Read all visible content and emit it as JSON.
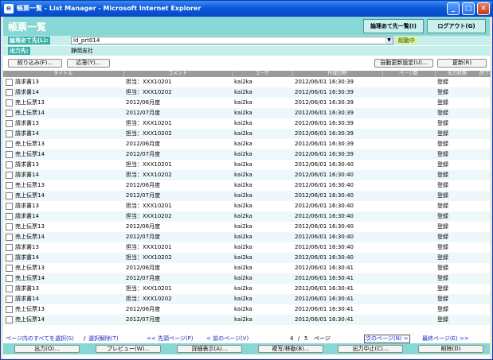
{
  "window": {
    "title": "帳票一覧 - List Manager - Microsoft Internet Explorer",
    "minimize": "_",
    "maximize": "□",
    "close": "✕"
  },
  "header": {
    "title": "帳票一覧",
    "logical_dest_button": "論理あて先一覧(I)",
    "logout_button": "ログアウト(G)"
  },
  "filter": {
    "dest_label": "論理あて先(L):",
    "dest_value": "ld_prt014",
    "dest_dropdown": "▼",
    "status": "起動中",
    "output_label": "出力先:",
    "output_value": "静岡支社"
  },
  "toolbar": {
    "narrow": "絞り込み(F)...",
    "respond": "応答(Y)...",
    "auto_refresh": "自動更新設定(U)...",
    "refresh": "更新(R)"
  },
  "table": {
    "columns": [
      "タイトル",
      "コメント",
      "ユーザ",
      "作成日時",
      "ページ数",
      "出力状態",
      "完了"
    ],
    "rows": [
      [
        "請求書13",
        "担当：XXX10201",
        "kai2ka",
        "2012/06/01 16:30:39",
        "",
        "登録",
        ""
      ],
      [
        "請求書14",
        "担当：XXX10202",
        "kai2ka",
        "2012/06/01 16:30:39",
        "",
        "登録",
        ""
      ],
      [
        "売上伝票13",
        "2012/06月度",
        "kai2ka",
        "2012/06/01 16:30:39",
        "",
        "登録",
        ""
      ],
      [
        "売上伝票14",
        "2012/07月度",
        "kai2ka",
        "2012/06/01 16:30:39",
        "",
        "登録",
        ""
      ],
      [
        "請求書13",
        "担当：XXX10201",
        "kai2ka",
        "2012/06/01 16:30:39",
        "",
        "登録",
        ""
      ],
      [
        "請求書14",
        "担当：XXX10202",
        "kai2ka",
        "2012/06/01 16:30:39",
        "",
        "登録",
        ""
      ],
      [
        "売上伝票13",
        "2012/06月度",
        "kai2ka",
        "2012/06/01 16:30:39",
        "",
        "登録",
        ""
      ],
      [
        "売上伝票14",
        "2012/07月度",
        "kai2ka",
        "2012/06/01 16:30:39",
        "",
        "登録",
        ""
      ],
      [
        "請求書13",
        "担当：XXX10201",
        "kai2ka",
        "2012/06/01 16:30:40",
        "",
        "登録",
        ""
      ],
      [
        "請求書14",
        "担当：XXX10202",
        "kai2ka",
        "2012/06/01 16:30:40",
        "",
        "登録",
        ""
      ],
      [
        "売上伝票13",
        "2012/06月度",
        "kai2ka",
        "2012/06/01 16:30:40",
        "",
        "登録",
        ""
      ],
      [
        "売上伝票14",
        "2012/07月度",
        "kai2ka",
        "2012/06/01 16:30:40",
        "",
        "登録",
        ""
      ],
      [
        "請求書13",
        "担当：XXX10201",
        "kai2ka",
        "2012/06/01 16:30:40",
        "",
        "登録",
        ""
      ],
      [
        "請求書14",
        "担当：XXX10202",
        "kai2ka",
        "2012/06/01 16:30:40",
        "",
        "登録",
        ""
      ],
      [
        "売上伝票13",
        "2012/06月度",
        "kai2ka",
        "2012/06/01 16:30:40",
        "",
        "登録",
        ""
      ],
      [
        "売上伝票14",
        "2012/07月度",
        "kai2ka",
        "2012/06/01 16:30:40",
        "",
        "登録",
        ""
      ],
      [
        "請求書13",
        "担当：XXX10201",
        "kai2ka",
        "2012/06/01 16:30:40",
        "",
        "登録",
        ""
      ],
      [
        "請求書14",
        "担当：XXX10202",
        "kai2ka",
        "2012/06/01 16:30:40",
        "",
        "登録",
        ""
      ],
      [
        "売上伝票13",
        "2012/06月度",
        "kai2ka",
        "2012/06/01 16:30:41",
        "",
        "登録",
        ""
      ],
      [
        "売上伝票14",
        "2012/07月度",
        "kai2ka",
        "2012/06/01 16:30:41",
        "",
        "登録",
        ""
      ],
      [
        "請求書13",
        "担当：XXX10201",
        "kai2ka",
        "2012/06/01 16:30:41",
        "",
        "登録",
        ""
      ],
      [
        "請求書14",
        "担当：XXX10202",
        "kai2ka",
        "2012/06/01 16:30:41",
        "",
        "登録",
        ""
      ],
      [
        "売上伝票13",
        "2012/06月度",
        "kai2ka",
        "2012/06/01 16:30:41",
        "",
        "登録",
        ""
      ],
      [
        "売上伝票14",
        "2012/07月度",
        "kai2ka",
        "2012/06/01 16:30:41",
        "",
        "登録",
        ""
      ]
    ]
  },
  "pager": {
    "select_all": "ページ内のすべてを選択(S)",
    "separator": "/",
    "deselect": "選択解除(T)",
    "first": "<< 先頭ページ(P)",
    "prev": "< 前のページ(V)",
    "current": "4",
    "slash": "/",
    "total": "5",
    "page_word": "ページ",
    "next": "次のページ(N) >",
    "last": "最終ページ(E) >>"
  },
  "actions": {
    "output": "出力(O)...",
    "preview": "プレビュー(W)...",
    "details": "詳細表示(A)...",
    "copy_move": "複写/移動(B)...",
    "stop": "出力中止(C)...",
    "delete": "削除(D)"
  },
  "colors": {
    "header_bg": "#88d7d7",
    "label_bg": "#34b0a8",
    "status_fg": "#6b8a17",
    "titlebar": "#0b58d8"
  }
}
